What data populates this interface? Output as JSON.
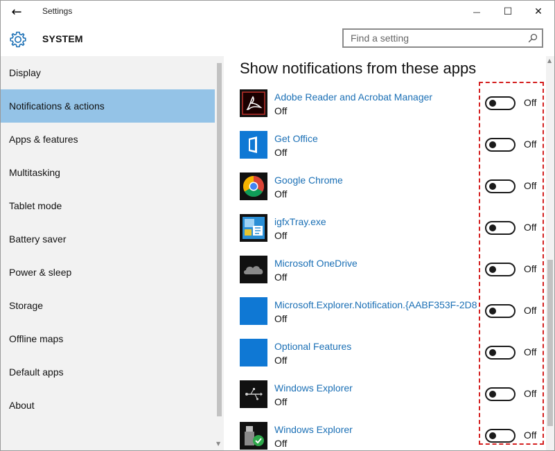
{
  "window": {
    "title": "Settings",
    "back_glyph": "←",
    "minimize_glyph": "—",
    "maximize_glyph": "☐",
    "close_glyph": "✕"
  },
  "header": {
    "title": "SYSTEM",
    "icon": "gear-icon",
    "search_placeholder": "Find a setting"
  },
  "sidebar": {
    "items": [
      {
        "label": "Display",
        "active": false
      },
      {
        "label": "Notifications & actions",
        "active": true
      },
      {
        "label": "Apps & features",
        "active": false
      },
      {
        "label": "Multitasking",
        "active": false
      },
      {
        "label": "Tablet mode",
        "active": false
      },
      {
        "label": "Battery saver",
        "active": false
      },
      {
        "label": "Power & sleep",
        "active": false
      },
      {
        "label": "Storage",
        "active": false
      },
      {
        "label": "Offline maps",
        "active": false
      },
      {
        "label": "Default apps",
        "active": false
      },
      {
        "label": "About",
        "active": false
      }
    ]
  },
  "main": {
    "heading": "Show notifications from these apps",
    "apps": [
      {
        "name": "Adobe Reader and Acrobat Manager",
        "status": "Off",
        "toggle": "Off",
        "icon": "adobe-icon"
      },
      {
        "name": "Get Office",
        "status": "Off",
        "toggle": "Off",
        "icon": "office-icon"
      },
      {
        "name": "Google Chrome",
        "status": "Off",
        "toggle": "Off",
        "icon": "chrome-icon"
      },
      {
        "name": "igfxTray.exe",
        "status": "Off",
        "toggle": "Off",
        "icon": "igfx-icon"
      },
      {
        "name": "Microsoft OneDrive",
        "status": "Off",
        "toggle": "Off",
        "icon": "onedrive-icon"
      },
      {
        "name": "Microsoft.Explorer.Notification.{AABF353F-2D8",
        "status": "Off",
        "toggle": "Off",
        "icon": "blank-app-icon"
      },
      {
        "name": "Optional Features",
        "status": "Off",
        "toggle": "Off",
        "icon": "blank-app-icon"
      },
      {
        "name": "Windows Explorer",
        "status": "Off",
        "toggle": "Off",
        "icon": "usb-icon"
      },
      {
        "name": "Windows Explorer",
        "status": "Off",
        "toggle": "Off",
        "icon": "usb-check-icon"
      }
    ]
  },
  "colors": {
    "accent": "#94c3e7",
    "link": "#1a6fb5",
    "highlight_border": "#d42020"
  }
}
